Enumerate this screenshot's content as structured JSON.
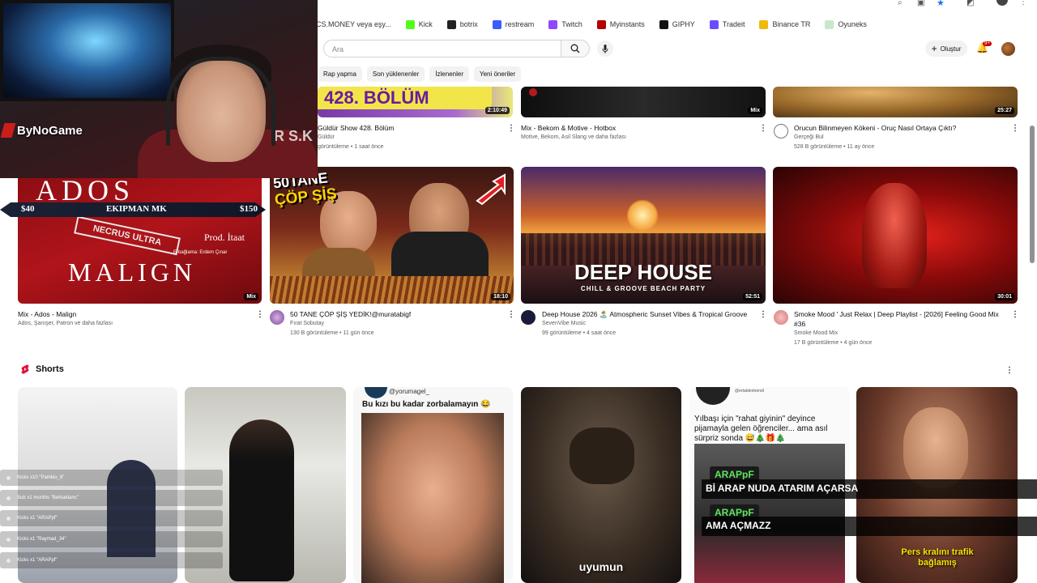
{
  "bookmarks": [
    {
      "label": "CS.MONEY veya eşy...",
      "color": "#7a7a7a"
    },
    {
      "label": "Kick",
      "color": "#53fc18"
    },
    {
      "label": "botrix",
      "color": "#222222"
    },
    {
      "label": "restream",
      "color": "#3b5cff"
    },
    {
      "label": "Twitch",
      "color": "#9146ff"
    },
    {
      "label": "Myinstants",
      "color": "#b30000"
    },
    {
      "label": "GIPHY",
      "color": "#111111"
    },
    {
      "label": "Tradeit",
      "color": "#6a4cff"
    },
    {
      "label": "Binance TR",
      "color": "#f0b90b"
    },
    {
      "label": "Oyuneks",
      "color": "#c8e8c8"
    }
  ],
  "header": {
    "search_placeholder": "Ara",
    "create_label": "Oluştur",
    "notification_count": "9+"
  },
  "chips": [
    "Rap yapma",
    "Son yüklenenler",
    "İzlenenler",
    "Yeni öneriler"
  ],
  "top_row": [
    {
      "title": "Güldür Show 428. Bölüm",
      "channel": "Güldür",
      "views": "görüntüleme • 1 saat önce",
      "duration": "2:10:49",
      "thumb_text": "428. BÖLÜM"
    },
    {
      "title": "Mix - Bekom & Motive - Hotbox",
      "channel": "Motive, Bekom, Asil Slang ve daha fazlası",
      "views": "",
      "duration": "Mix"
    },
    {
      "title": "Orucun Bilinmeyen Kökeni - Oruç Nasıl Ortaya Çıktı?",
      "channel": "Gerçeği Bul",
      "views": "528 B görüntüleme • 11 ay önce",
      "duration": "25:27"
    }
  ],
  "main_row": [
    {
      "title": "Mix - Ados - Malign",
      "channel": "Ados, Şanışer, Patron ve daha fazlası",
      "views": "",
      "duration": "Mix",
      "thumb_top": "ADOS",
      "thumb_bottom": "MALIGN",
      "thumb_sub": "Prod. İtaat",
      "thumb_credit": "E-bağlama: Erdem Çınar",
      "thumb_mid": "NECRUS ULTRA"
    },
    {
      "title": "50 TANE ÇÖP ŞİŞ YEDİK!@muratabigf",
      "channel": "Fırat Sobutay",
      "views": "130 B görüntüleme • 11 gün önce",
      "duration": "18:10",
      "thumb_text_1": "50TANE",
      "thumb_text_2": "ÇÖP ŞİŞ"
    },
    {
      "title": "Deep House 2026 🏝️ Atmospheric Sunset Vibes & Tropical Groove",
      "channel": "SevenVibe Music",
      "views": "99 görüntüleme • 4 saat önce",
      "duration": "52:51",
      "thumb_text_1": "DEEP HOUSE",
      "thumb_text_2": "CHILL & GROOVE BEACH PARTY"
    },
    {
      "title": "Smoke Mood ' Just Relax | Deep Playlist - [2026] Feeling Good Mix",
      "title2": "#36",
      "channel": "Smoke Mood Mix",
      "views": "17 B görüntüleme • 4 gün önce",
      "duration": "30:01"
    }
  ],
  "overlay_banner": {
    "left_price": "$40",
    "center": "EKIPMAN MK",
    "right_price": "$150"
  },
  "streamer": {
    "logo": "ByNoGame",
    "hoodie_text": "R S.K"
  },
  "shorts": {
    "heading": "Shorts",
    "items": [
      {
        "top": "",
        "bottom": ""
      },
      {
        "top": "",
        "bottom": ""
      },
      {
        "handle": "@yorumagel_",
        "top": "Bu kızı bu kadar zorbalamayın 😂",
        "bottom": ""
      },
      {
        "top": "",
        "bottom": "uyumun"
      },
      {
        "handle": "@ertatdentrendi",
        "top": "Yılbaşı için \"rahat giyinin\" deyince pijamayla gelen öğrenciler... ama asıl sürpriz sonda 😅🎄🎁🎄",
        "bottom": ""
      },
      {
        "top": "",
        "bottom": "Pers kralını trafik bağlamış"
      }
    ]
  },
  "chat": [
    "Kicks x10 \"Pamkio_8\"",
    "Sub x1 months \"Berkaktanc\"",
    "Kicks x1 \"ARAPpf\"",
    "Kicks x1 \"Raymad_34\"",
    "Kicks x1 \"ARAPpf\""
  ],
  "donation_overlay": [
    {
      "user": "ARAPpF",
      "message": "Bİ ARAP NUDA ATARIM AÇARSA"
    },
    {
      "user": "ARAPpF",
      "message": "AMA AÇMAZZ"
    }
  ],
  "colors": {
    "accent": "#cc0000",
    "chip_bg": "#f2f2f2"
  }
}
